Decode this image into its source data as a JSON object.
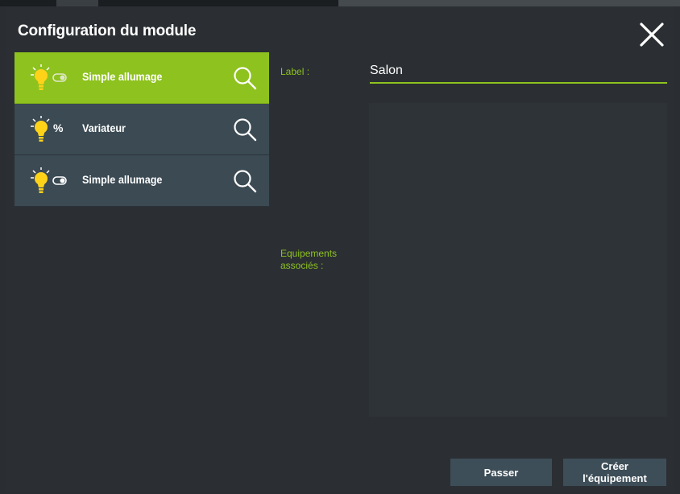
{
  "dialog": {
    "title": "Configuration du module"
  },
  "modules": [
    {
      "label": "Simple allumage",
      "type": "switch",
      "active": true
    },
    {
      "label": "Variateur",
      "type": "dimmer",
      "suffix": "%",
      "active": false
    },
    {
      "label": "Simple allumage",
      "type": "switch",
      "active": false
    }
  ],
  "form": {
    "label_caption": "Label :",
    "label_value": "Salon",
    "equipements_caption_line1": "Equipements",
    "equipements_caption_line2": "associés :"
  },
  "buttons": {
    "passer": "Passer",
    "creer_line1": "Créer",
    "creer_line2": "l'équipement"
  },
  "colors": {
    "accent": "#8ec21f",
    "row_bg": "#3b4a53",
    "background": "#2b2f33",
    "bulb": "#ffd21a"
  }
}
